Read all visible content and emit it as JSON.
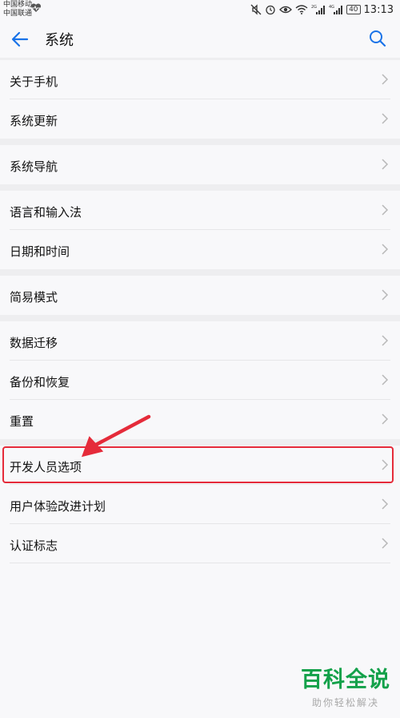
{
  "status_bar": {
    "carrier1": "中国移动",
    "carrier2": "中国联通",
    "network1": "2G",
    "network2": "4G",
    "battery": "40",
    "time": "13:13"
  },
  "header": {
    "title": "系统"
  },
  "groups": [
    {
      "items": [
        "关于手机",
        "系统更新"
      ]
    },
    {
      "items": [
        "系统导航"
      ]
    },
    {
      "items": [
        "语言和输入法",
        "日期和时间"
      ]
    },
    {
      "items": [
        "简易模式"
      ]
    },
    {
      "items": [
        "数据迁移",
        "备份和恢复",
        "重置"
      ]
    },
    {
      "items": [
        "开发人员选项",
        "用户体验改进计划",
        "认证标志"
      ]
    }
  ],
  "annotation": {
    "highlight_color": "#e52b3a"
  },
  "watermark": {
    "title": "百科全说",
    "subtitle": "助你轻松解决"
  }
}
